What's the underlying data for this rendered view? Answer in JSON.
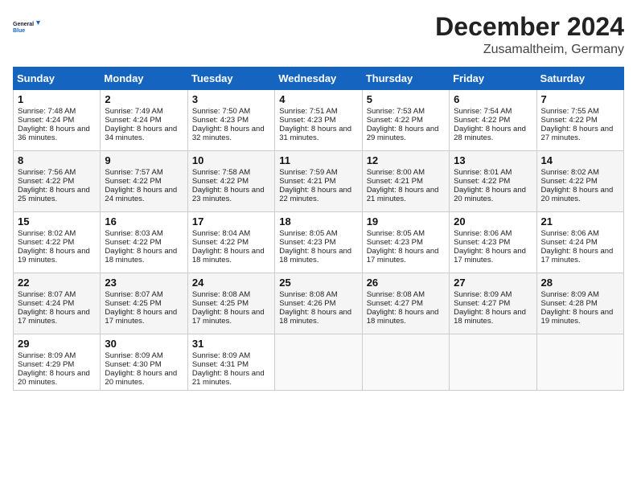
{
  "header": {
    "logo_line1": "General",
    "logo_line2": "Blue",
    "month": "December 2024",
    "location": "Zusamaltheim, Germany"
  },
  "weekdays": [
    "Sunday",
    "Monday",
    "Tuesday",
    "Wednesday",
    "Thursday",
    "Friday",
    "Saturday"
  ],
  "weeks": [
    [
      {
        "day": "1",
        "sunrise": "7:48 AM",
        "sunset": "4:24 PM",
        "daylight": "8 hours and 36 minutes."
      },
      {
        "day": "2",
        "sunrise": "7:49 AM",
        "sunset": "4:24 PM",
        "daylight": "8 hours and 34 minutes."
      },
      {
        "day": "3",
        "sunrise": "7:50 AM",
        "sunset": "4:23 PM",
        "daylight": "8 hours and 32 minutes."
      },
      {
        "day": "4",
        "sunrise": "7:51 AM",
        "sunset": "4:23 PM",
        "daylight": "8 hours and 31 minutes."
      },
      {
        "day": "5",
        "sunrise": "7:53 AM",
        "sunset": "4:22 PM",
        "daylight": "8 hours and 29 minutes."
      },
      {
        "day": "6",
        "sunrise": "7:54 AM",
        "sunset": "4:22 PM",
        "daylight": "8 hours and 28 minutes."
      },
      {
        "day": "7",
        "sunrise": "7:55 AM",
        "sunset": "4:22 PM",
        "daylight": "8 hours and 27 minutes."
      }
    ],
    [
      {
        "day": "8",
        "sunrise": "7:56 AM",
        "sunset": "4:22 PM",
        "daylight": "8 hours and 25 minutes."
      },
      {
        "day": "9",
        "sunrise": "7:57 AM",
        "sunset": "4:22 PM",
        "daylight": "8 hours and 24 minutes."
      },
      {
        "day": "10",
        "sunrise": "7:58 AM",
        "sunset": "4:22 PM",
        "daylight": "8 hours and 23 minutes."
      },
      {
        "day": "11",
        "sunrise": "7:59 AM",
        "sunset": "4:21 PM",
        "daylight": "8 hours and 22 minutes."
      },
      {
        "day": "12",
        "sunrise": "8:00 AM",
        "sunset": "4:21 PM",
        "daylight": "8 hours and 21 minutes."
      },
      {
        "day": "13",
        "sunrise": "8:01 AM",
        "sunset": "4:22 PM",
        "daylight": "8 hours and 20 minutes."
      },
      {
        "day": "14",
        "sunrise": "8:02 AM",
        "sunset": "4:22 PM",
        "daylight": "8 hours and 20 minutes."
      }
    ],
    [
      {
        "day": "15",
        "sunrise": "8:02 AM",
        "sunset": "4:22 PM",
        "daylight": "8 hours and 19 minutes."
      },
      {
        "day": "16",
        "sunrise": "8:03 AM",
        "sunset": "4:22 PM",
        "daylight": "8 hours and 18 minutes."
      },
      {
        "day": "17",
        "sunrise": "8:04 AM",
        "sunset": "4:22 PM",
        "daylight": "8 hours and 18 minutes."
      },
      {
        "day": "18",
        "sunrise": "8:05 AM",
        "sunset": "4:23 PM",
        "daylight": "8 hours and 18 minutes."
      },
      {
        "day": "19",
        "sunrise": "8:05 AM",
        "sunset": "4:23 PM",
        "daylight": "8 hours and 17 minutes."
      },
      {
        "day": "20",
        "sunrise": "8:06 AM",
        "sunset": "4:23 PM",
        "daylight": "8 hours and 17 minutes."
      },
      {
        "day": "21",
        "sunrise": "8:06 AM",
        "sunset": "4:24 PM",
        "daylight": "8 hours and 17 minutes."
      }
    ],
    [
      {
        "day": "22",
        "sunrise": "8:07 AM",
        "sunset": "4:24 PM",
        "daylight": "8 hours and 17 minutes."
      },
      {
        "day": "23",
        "sunrise": "8:07 AM",
        "sunset": "4:25 PM",
        "daylight": "8 hours and 17 minutes."
      },
      {
        "day": "24",
        "sunrise": "8:08 AM",
        "sunset": "4:25 PM",
        "daylight": "8 hours and 17 minutes."
      },
      {
        "day": "25",
        "sunrise": "8:08 AM",
        "sunset": "4:26 PM",
        "daylight": "8 hours and 18 minutes."
      },
      {
        "day": "26",
        "sunrise": "8:08 AM",
        "sunset": "4:27 PM",
        "daylight": "8 hours and 18 minutes."
      },
      {
        "day": "27",
        "sunrise": "8:09 AM",
        "sunset": "4:27 PM",
        "daylight": "8 hours and 18 minutes."
      },
      {
        "day": "28",
        "sunrise": "8:09 AM",
        "sunset": "4:28 PM",
        "daylight": "8 hours and 19 minutes."
      }
    ],
    [
      {
        "day": "29",
        "sunrise": "8:09 AM",
        "sunset": "4:29 PM",
        "daylight": "8 hours and 20 minutes."
      },
      {
        "day": "30",
        "sunrise": "8:09 AM",
        "sunset": "4:30 PM",
        "daylight": "8 hours and 20 minutes."
      },
      {
        "day": "31",
        "sunrise": "8:09 AM",
        "sunset": "4:31 PM",
        "daylight": "8 hours and 21 minutes."
      },
      null,
      null,
      null,
      null
    ]
  ]
}
